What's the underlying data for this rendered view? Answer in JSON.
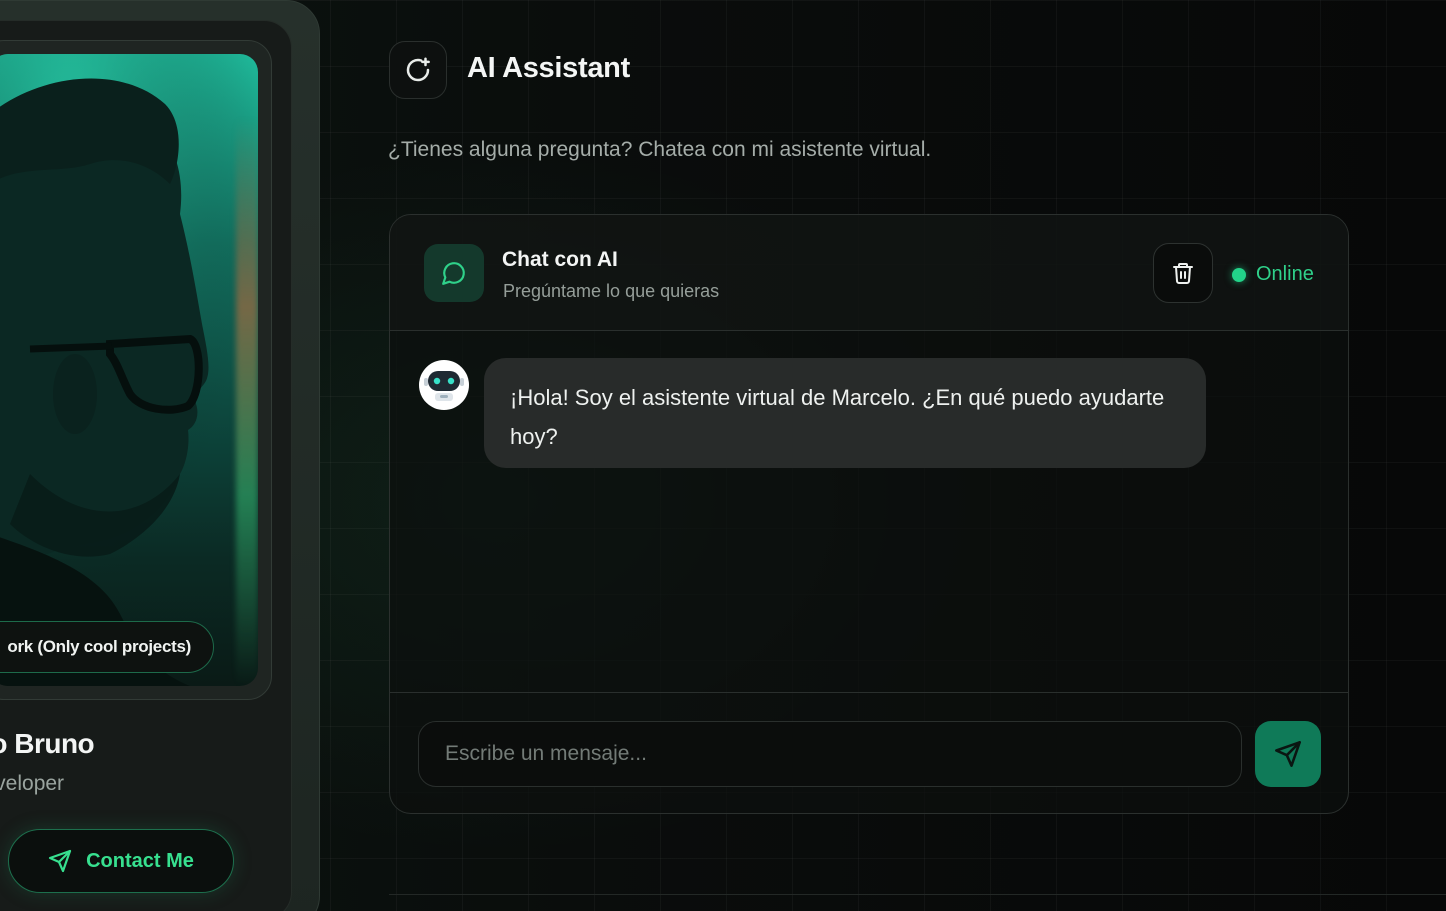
{
  "profile": {
    "availability": "ork (Only cool projects)",
    "name": "elo Bruno",
    "role": "k Developer",
    "contact_label": "Contact Me",
    "contact_icon": "send-icon"
  },
  "header": {
    "icon": "ai-refresh-icon",
    "title": "AI Assistant",
    "subtitle": "¿Tienes alguna pregunta? Chatea con mi asistente virtual."
  },
  "chat": {
    "title": "Chat con AI",
    "subtitle": "Pregúntame lo que quieras",
    "header_icon": "chat-bubble-icon",
    "clear_icon": "trash-icon",
    "status": "Online",
    "status_color": "#22d389",
    "messages": [
      {
        "sender": "assistant",
        "avatar": "robot-avatar",
        "text": "¡Hola! Soy el asistente virtual de Marcelo. ¿En qué puedo ayudarte hoy?"
      }
    ],
    "input": {
      "value": "",
      "placeholder": "Escribe un mensaje..."
    },
    "send_icon": "send-icon"
  },
  "colors": {
    "accent": "#2fd18a",
    "accent_dark": "#0f7a58"
  }
}
